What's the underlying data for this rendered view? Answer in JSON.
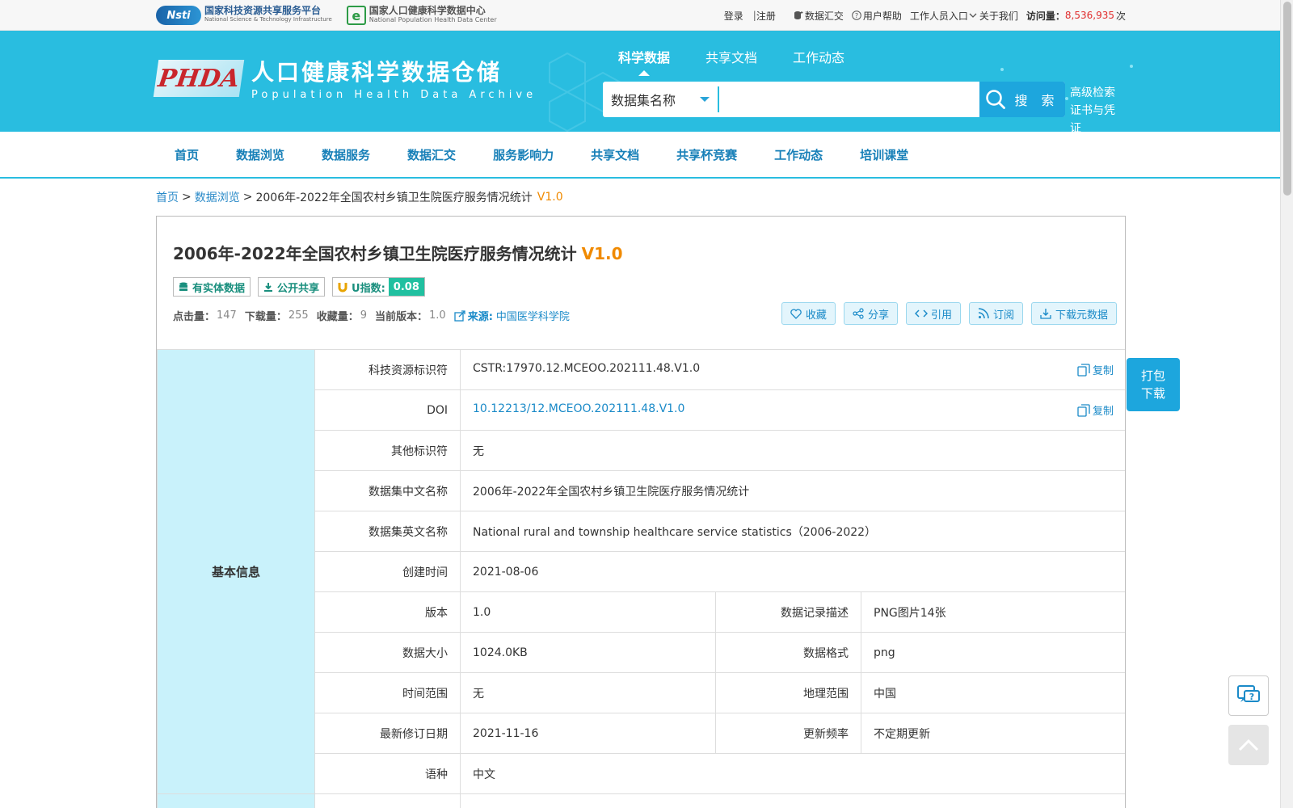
{
  "topbar": {
    "logo1_mark": "Nsti",
    "logo1_cn": "国家科技资源共享服务平台",
    "logo1_en": "National Science & Technology Infrastructure",
    "logo2_mark": "e",
    "logo2_cn": "国家人口健康科学数据中心",
    "logo2_en": "National Population Health Data Center",
    "login": "登录",
    "sep": "|",
    "register": "注册",
    "data_submit": "数据汇交",
    "user_help": "用户帮助",
    "staff_entry": "工作人员入口",
    "about": "关于我们",
    "visits_label": "访问量：",
    "visits_num": "8,536,935",
    "visits_unit": "次"
  },
  "header": {
    "logo_mark": "PHDA",
    "title_cn": "人口健康科学数据仓储",
    "title_en": "Population Health Data Archive",
    "nav": [
      "科学数据",
      "共享文档",
      "工作动态"
    ],
    "search_select": "数据集名称",
    "search_value": "",
    "search_button": "搜 索",
    "advanced": "高级检索",
    "certificate": "证书与凭证"
  },
  "mainnav": [
    "首页",
    "数据浏览",
    "数据服务",
    "数据汇交",
    "服务影响力",
    "共享文档",
    "共享杯竞赛",
    "工作动态",
    "培训课堂"
  ],
  "breadcrumb": {
    "home": "首页",
    "browse": "数据浏览",
    "gt": ">",
    "current": "2006年-2022年全国农村乡镇卫生院医疗服务情况统计",
    "version": "V1.0"
  },
  "dataset": {
    "title": "2006年-2022年全国农村乡镇卫生院医疗服务情况统计",
    "version": "V1.0",
    "tag_entity": "有实体数据",
    "tag_open": "公开共享",
    "tag_u_label": "U指数:",
    "tag_u_value": "0.08",
    "stats": {
      "clicks_label": "点击量：",
      "clicks": "147",
      "downloads_label": "下载量：",
      "downloads": "255",
      "favorites_label": "收藏量：",
      "favorites": "9",
      "version_label": "当前版本：",
      "version": "1.0",
      "source_label": "来源:",
      "source": "中国医学科学院"
    },
    "actions": [
      "收藏",
      "分享",
      "引用",
      "订阅",
      "下载元数据"
    ],
    "section_basic": "基本信息",
    "copy_label": "复制",
    "rows": {
      "cstr_k": "科技资源标识符",
      "cstr_v": "CSTR:17970.12.MCEOO.202111.48.V1.0",
      "doi_k": "DOI",
      "doi_v": "10.12213/12.MCEOO.202111.48.V1.0",
      "other_k": "其他标识符",
      "other_v": "无",
      "cn_name_k": "数据集中文名称",
      "cn_name_v": "2006年-2022年全国农村乡镇卫生院医疗服务情况统计",
      "en_name_k": "数据集英文名称",
      "en_name_v": "National rural and township healthcare service statistics（2006-2022）",
      "created_k": "创建时间",
      "created_v": "2021-08-06",
      "version_k": "版本",
      "version_v": "1.0",
      "record_k": "数据记录描述",
      "record_v": "PNG图片14张",
      "size_k": "数据大小",
      "size_v": "1024.0KB",
      "format_k": "数据格式",
      "format_v": "png",
      "time_k": "时间范围",
      "time_v": "无",
      "geo_k": "地理范围",
      "geo_v": "中国",
      "revised_k": "最新修订日期",
      "revised_v": "2021-11-16",
      "freq_k": "更新频率",
      "freq_v": "不定期更新",
      "lang_k": "语种",
      "lang_v": "中文"
    }
  },
  "float": {
    "pack_line1": "打包",
    "pack_line2": "下载"
  }
}
